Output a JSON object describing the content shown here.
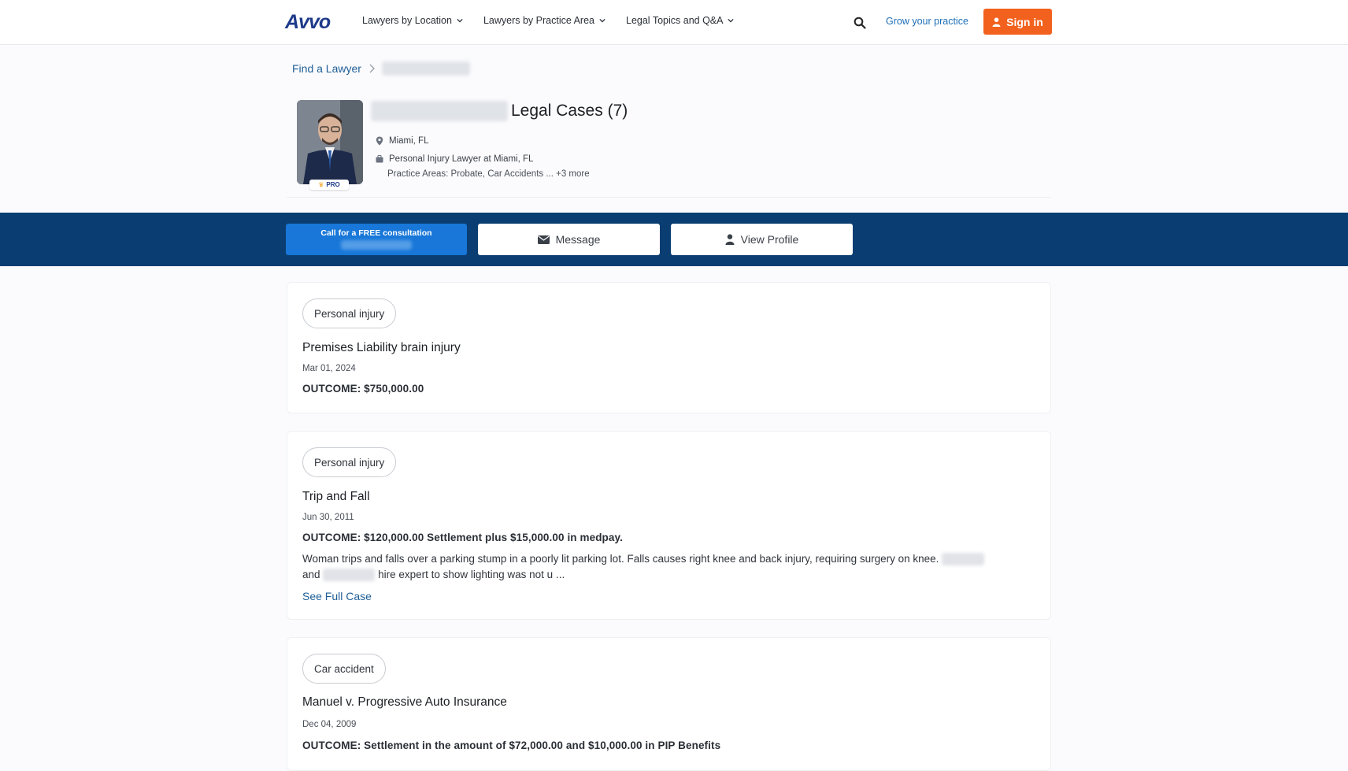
{
  "nav": {
    "logo": "Avvo",
    "menu": [
      {
        "label": "Lawyers by Location"
      },
      {
        "label": "Lawyers by Practice Area"
      },
      {
        "label": "Legal Topics and Q&A"
      }
    ],
    "grow_link": "Grow your practice",
    "signin_label": "Sign in",
    "accent_color": "#f2611d"
  },
  "breadcrumb": {
    "root": "Find a Lawyer"
  },
  "profile": {
    "title": "Legal Cases (7)",
    "location": "Miami, FL",
    "headline": "Personal Injury Lawyer at Miami, FL",
    "practice_areas": "Practice Areas: Probate, Car Accidents ... +3 more",
    "badge": "PRO"
  },
  "actions": {
    "call_label": "Call for a FREE consultation",
    "message_label": "Message",
    "view_profile_label": "View Profile",
    "bar_color": "#0a3e72"
  },
  "cases": [
    {
      "tag": "Personal injury",
      "title": "Premises Liability brain injury",
      "date": "Mar 01, 2024",
      "outcome": "OUTCOME: $750,000.00"
    },
    {
      "tag": "Personal injury",
      "title": "Trip and Fall",
      "date": "Jun 30, 2011",
      "outcome": "OUTCOME: $120,000.00 Settlement plus $15,000.00 in medpay.",
      "desc_part1": "Woman trips and falls over a parking stump in a poorly lit parking lot. Falls causes right knee and back injury, requiring surgery on knee.",
      "desc_part2": "and",
      "desc_part3": "hire expert to show lighting was not u ...",
      "link": "See Full Case"
    },
    {
      "tag": "Car accident",
      "title": "Manuel v. Progressive Auto Insurance",
      "date": "Dec 04, 2009",
      "outcome": "OUTCOME: Settlement in the amount of $72,000.00 and $10,000.00 in PIP Benefits"
    }
  ]
}
